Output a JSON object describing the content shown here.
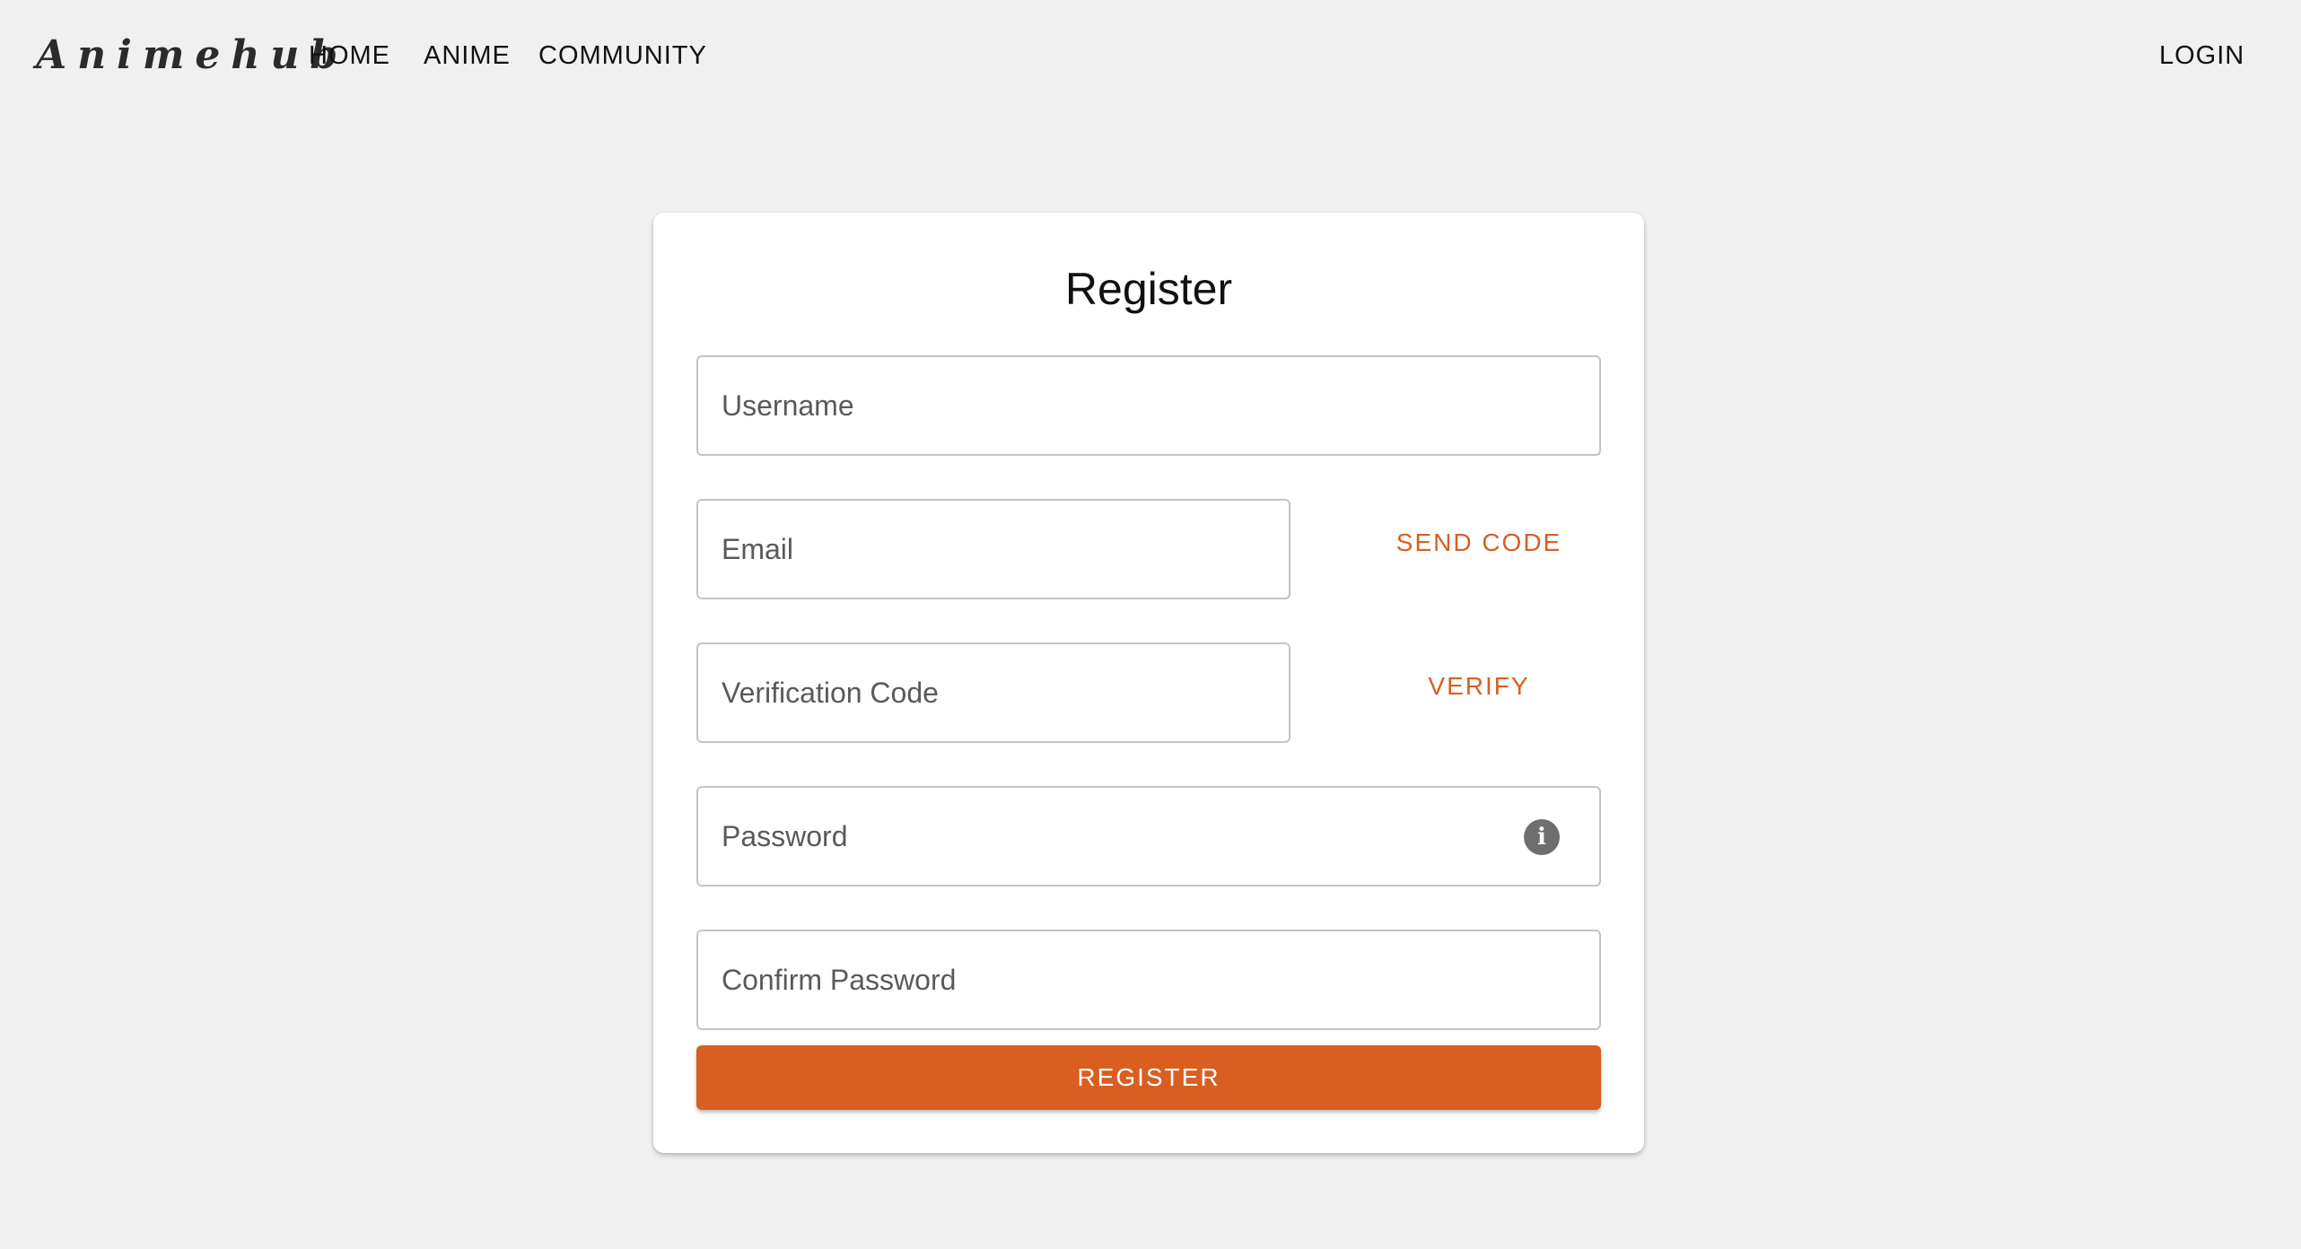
{
  "header": {
    "brand": "Animehub",
    "nav": {
      "home": "HOME",
      "anime": "ANIME",
      "community": "COMMUNITY"
    },
    "login": "LOGIN"
  },
  "form": {
    "title": "Register",
    "username_placeholder": "Username",
    "email_placeholder": "Email",
    "send_code_label": "SEND CODE",
    "verification_placeholder": "Verification Code",
    "verify_label": "VERIFY",
    "password_placeholder": "Password",
    "password_info_icon": "info-icon",
    "confirm_password_placeholder": "Confirm Password",
    "register_label": "REGISTER"
  },
  "colors": {
    "accent": "#d85e21",
    "background": "#f0f0f0",
    "card": "#ffffff"
  }
}
